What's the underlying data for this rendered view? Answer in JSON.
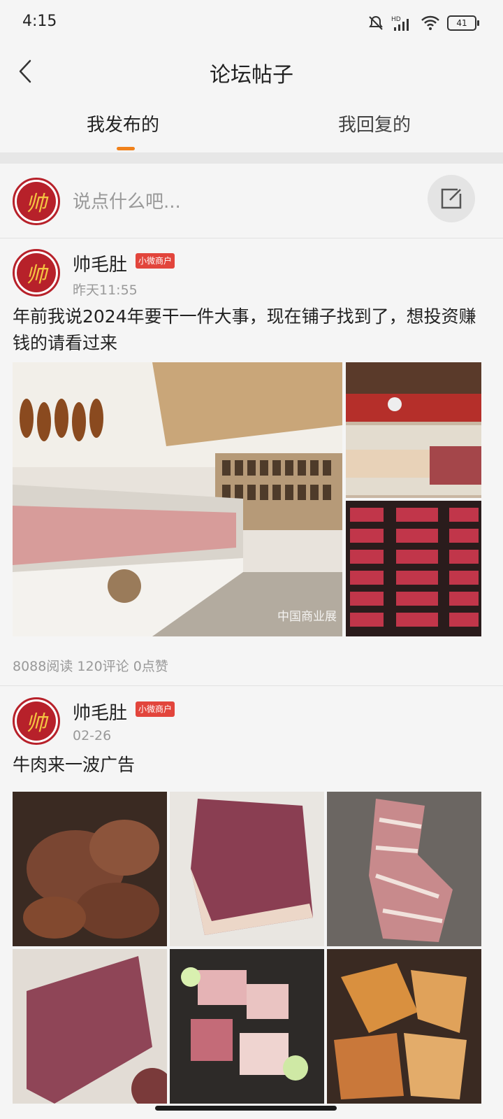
{
  "status": {
    "time": "4:15",
    "signal_label": "HD",
    "battery": "41"
  },
  "nav": {
    "title": "论坛帖子"
  },
  "tabs": [
    {
      "label": "我发布的",
      "active": true
    },
    {
      "label": "我回复的",
      "active": false
    }
  ],
  "compose": {
    "placeholder": "说点什么吧..."
  },
  "avatar_glyph": "帅",
  "posts": [
    {
      "author": "帅毛肚",
      "badge": "小微商户",
      "time": "昨天11:55",
      "text": "年前我说2024年要干一件大事，现在铺子找到了，想投资赚钱的请看过来",
      "image_caption": "中国商业展",
      "stats": "8088阅读 120评论 0点赞"
    },
    {
      "author": "帅毛肚",
      "badge": "小微商户",
      "time": "02-26",
      "text": "牛肉来一波广告"
    }
  ],
  "colors": {
    "accent": "#f0811a",
    "brand_red": "#b7212a",
    "badge_red": "#e2453c"
  }
}
